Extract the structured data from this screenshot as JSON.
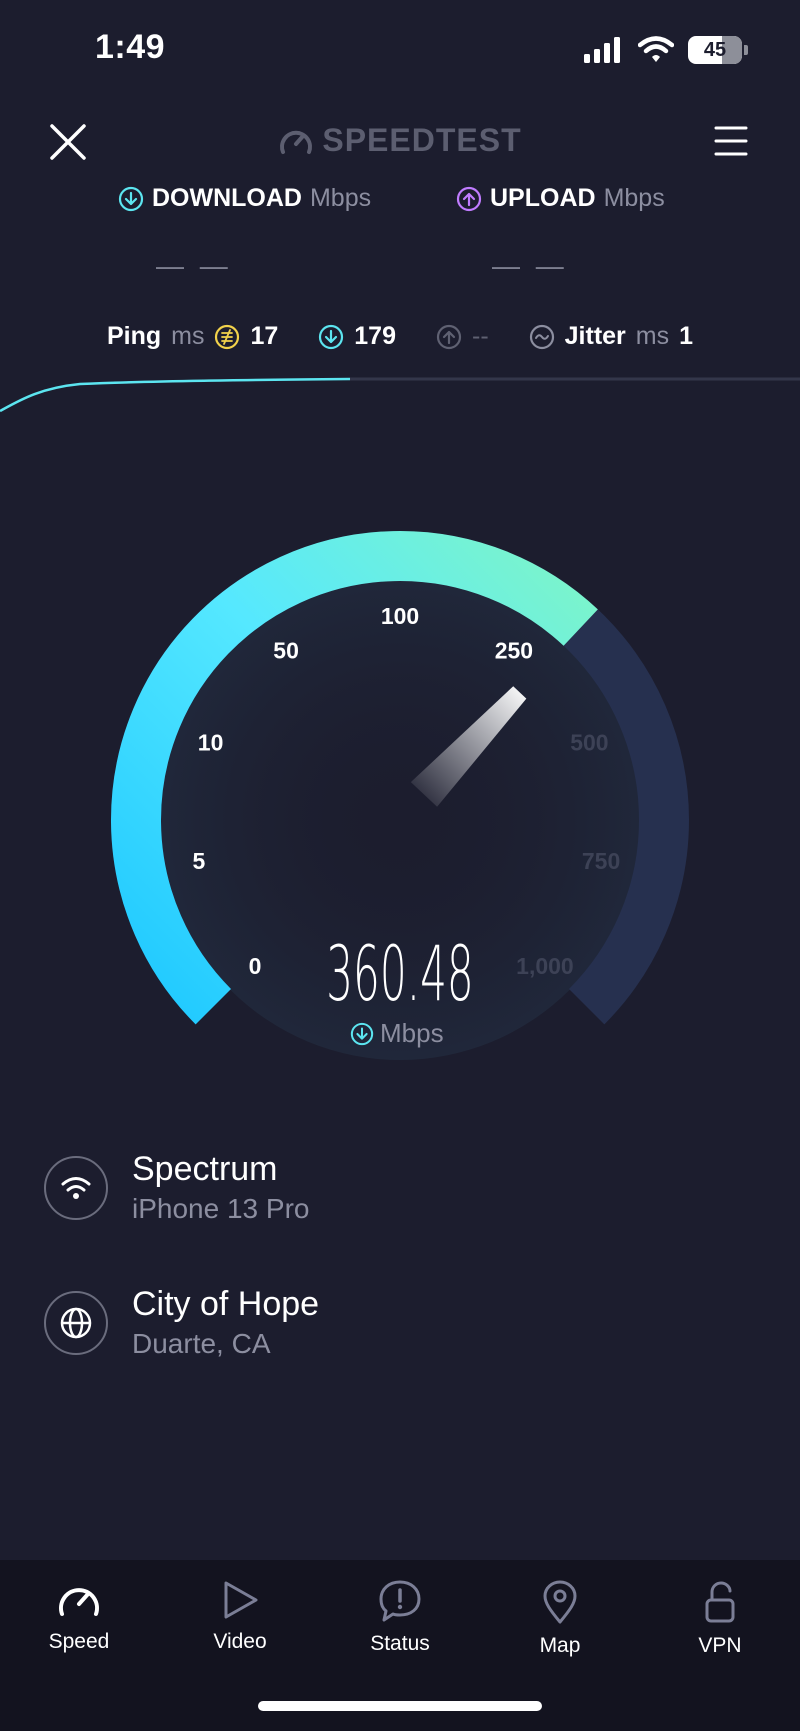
{
  "status_bar": {
    "time": "1:49",
    "battery": "45"
  },
  "header": {
    "app_name": "SPEEDTEST"
  },
  "download": {
    "label": "DOWNLOAD",
    "unit": "Mbps",
    "value": "— —",
    "color": "#5ce5f0"
  },
  "upload": {
    "label": "UPLOAD",
    "unit": "Mbps",
    "value": "— —",
    "color": "#c07cff"
  },
  "ping": {
    "label": "Ping",
    "unit": "ms",
    "idle": "17",
    "download": "179",
    "upload": "--"
  },
  "jitter": {
    "label": "Jitter",
    "unit": "ms",
    "value": "1"
  },
  "gauge": {
    "reading": "360.48",
    "unit": "Mbps",
    "scale_labels": [
      "0",
      "5",
      "10",
      "50",
      "100",
      "250",
      "500",
      "750",
      "1,000"
    ],
    "active_color_start": "#1ec8ff",
    "active_color_end": "#7ef5c8",
    "inactive_color": "#26304f",
    "progress": 0.66
  },
  "provider": {
    "name": "Spectrum",
    "device": "iPhone 13 Pro"
  },
  "server": {
    "name": "City of Hope",
    "location": "Duarte, CA"
  },
  "nav": {
    "items": [
      {
        "label": "Speed",
        "icon": "speedometer-icon"
      },
      {
        "label": "Video",
        "icon": "play-icon"
      },
      {
        "label": "Status",
        "icon": "alert-icon"
      },
      {
        "label": "Map",
        "icon": "map-pin-icon"
      },
      {
        "label": "VPN",
        "icon": "unlock-icon"
      }
    ]
  }
}
